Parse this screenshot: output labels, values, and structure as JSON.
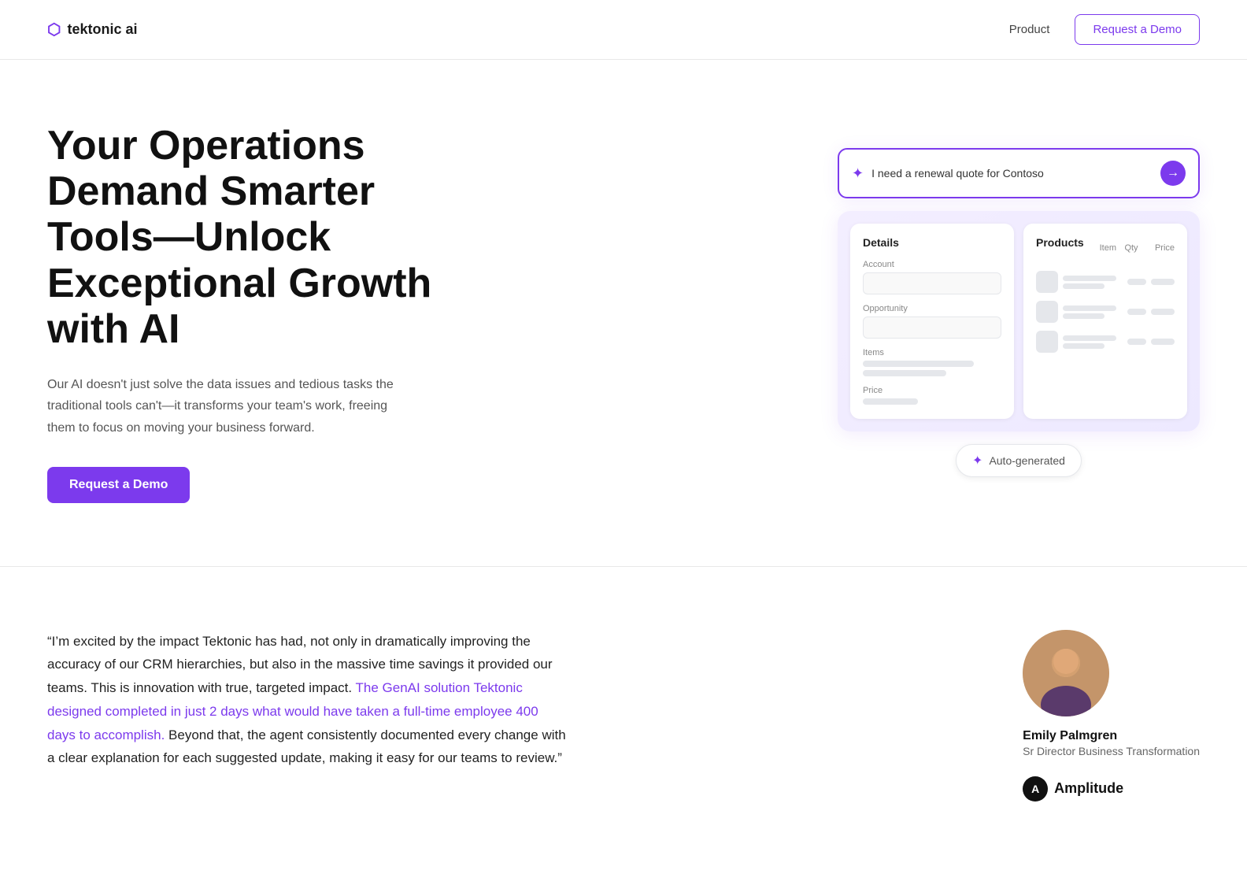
{
  "nav": {
    "logo_text": "tektonic ai",
    "logo_icon": "⬡",
    "links": [
      {
        "label": "Product",
        "id": "product"
      }
    ],
    "cta_label": "Request a Demo"
  },
  "hero": {
    "title": "Your Operations Demand Smarter Tools—Unlock Exceptional Growth with AI",
    "description": "Our AI doesn't just solve the data issues and tedious tasks the traditional tools can't—it transforms your team's work, freeing them to focus on moving your business forward.",
    "cta_label": "Request a Demo"
  },
  "demo_card": {
    "search_placeholder": "I need a renewal quote for Contoso",
    "sparkle_icon": "✦",
    "arrow_icon": "→",
    "details_panel_title": "Details",
    "fields": [
      {
        "label": "Account"
      },
      {
        "label": "Opportunity"
      },
      {
        "label": "Items"
      },
      {
        "label": "Price"
      }
    ],
    "products_panel_title": "Products",
    "products_cols": {
      "item": "Item",
      "qty": "Qty",
      "price": "Price"
    },
    "auto_generated_label": "Auto-generated"
  },
  "testimonial": {
    "quote_start": "“I’m excited by the impact Tektonic has had, not only in dramatically improving the accuracy of our CRM hierarchies, but also in the massive time savings it provided our teams. This is innovation with true, targeted impact. ",
    "quote_highlight": "The GenAI solution Tektonic designed completed in just 2 days what would have taken a full-time employee 400 days to accomplish.",
    "quote_end": " Beyond that, the agent consistently documented every change with a clear explanation for each suggested update, making it easy for our teams to review.”",
    "person_name": "Emily Palmgren",
    "person_title": "Sr Director Business Transformation",
    "company_name": "Amplitude",
    "company_icon_letter": "A"
  }
}
